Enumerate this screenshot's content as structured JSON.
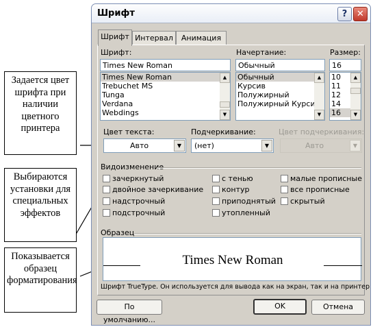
{
  "callouts": {
    "color": "Задается цвет шрифта при наличии цветного принтера",
    "effects": "Выбираются установки для специальных эффектов",
    "sample": "Показывается образец форматирования"
  },
  "dialog": {
    "title": "Шрифт",
    "help_icon": "?",
    "close_icon": "✕",
    "tabs": [
      "Шрифт",
      "Интервал",
      "Анимация"
    ],
    "font": {
      "label": "Шрифт:",
      "value": "Times New Roman",
      "items": [
        "Times New Roman",
        "Trebuchet MS",
        "Tunga",
        "Verdana",
        "Webdings"
      ]
    },
    "style": {
      "label": "Начертание:",
      "value": "Обычный",
      "items": [
        "Обычный",
        "Курсив",
        "Полужирный",
        "Полужирный Курсив"
      ]
    },
    "size": {
      "label": "Размер:",
      "value": "16",
      "items": [
        "10",
        "11",
        "12",
        "14",
        "16"
      ]
    },
    "text_color": {
      "label": "Цвет текста:",
      "value": "Авто"
    },
    "underline": {
      "label": "Подчеркивание:",
      "value": "(нет)"
    },
    "underline_color": {
      "label": "Цвет подчеркивания:",
      "value": "Авто"
    },
    "effects": {
      "label": "Видоизменение",
      "items": [
        {
          "label": "зачеркнутый",
          "checked": false
        },
        {
          "label": "двойное зачеркивание",
          "checked": false
        },
        {
          "label": "надстрочный",
          "checked": false
        },
        {
          "label": "подстрочный",
          "checked": false
        },
        {
          "label": "с тенью",
          "checked": false
        },
        {
          "label": "контур",
          "checked": false
        },
        {
          "label": "приподнятый",
          "checked": false
        },
        {
          "label": "утопленный",
          "checked": false
        },
        {
          "label": "малые прописные",
          "checked": false
        },
        {
          "label": "все прописные",
          "checked": false
        },
        {
          "label": "скрытый",
          "checked": false
        }
      ]
    },
    "sample": {
      "label": "Образец",
      "text": "Times New Roman",
      "note": "Шрифт TrueType. Он используется для вывода как на экран, так и на принтер."
    },
    "buttons": {
      "default": "По умолчанию...",
      "ok": "OK",
      "cancel": "Отмена"
    },
    "colors": {
      "face": "#d4d0c8",
      "field_border": "#7f9db9",
      "selected_item": "#d6d3ce"
    }
  }
}
